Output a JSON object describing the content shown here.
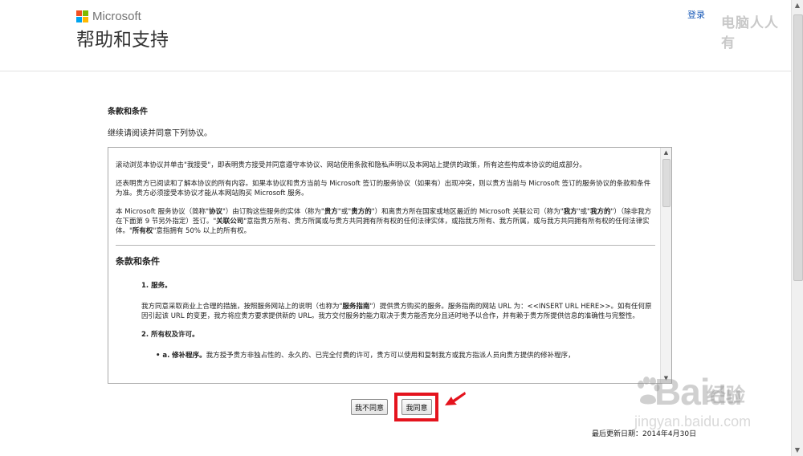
{
  "header": {
    "brand": "Microsoft",
    "title": "帮助和支持",
    "signin_label": "登录",
    "watermark": "电脑人人有"
  },
  "brand_colors": {
    "red": "#f25022",
    "green": "#7fba00",
    "blue": "#00a4ef",
    "yellow": "#ffb900"
  },
  "terms": {
    "heading": "条款和条件",
    "intro": "继续请阅读并同意下列协议。"
  },
  "agreement": {
    "p1": "滚动浏览本协议并单击\"我接受\"，即表明贵方接受并同意遵守本协议、网站使用条款和隐私声明以及本网站上提供的政策，所有这些构成本协议的组成部分。",
    "p2": "还表明贵方已阅读和了解本协议的所有内容。如果本协议和贵方当前与 Microsoft 签订的服务协议（如果有）出现冲突，则以贵方当前与 Microsoft 签订的服务协议的条款和条件为准。贵方必须接受本协议才能从本网站购买 Microsoft 服务。",
    "p3_a": "本 Microsoft 服务协议（简称\"",
    "p3_b": "协议",
    "p3_c": "\"）由订购这些服务的实体（称为\"",
    "p3_d": "贵方",
    "p3_e": "\"或\"",
    "p3_f": "贵方的",
    "p3_g": "\"）和离贵方所在国家或地区最近的 Microsoft 关联公司（称为\"",
    "p3_h": "我方",
    "p3_i": "\"或\"",
    "p3_j": "我方的",
    "p3_k": "\"）（除非我方在下面第 9 节另外指定）签订。\"",
    "p3_l": "关联公司",
    "p3_m": "\"意指贵方所有、贵方所属或与贵方共同拥有所有权的任何法律实体，或指我方所有、我方所属，或与我方共同拥有所有权的任何法律实体。\"",
    "p3_n": "所有权",
    "p3_o": "\"意指拥有 50% 以上的所有权。",
    "section_title": "条款和条件",
    "s1_title": "1. 服务。",
    "s1_a": "我方同意采取商业上合理的措施，按照服务网站上的说明（也称为\"",
    "s1_b": "服务指南",
    "s1_c": "\"）提供贵方购买的服务。服务指南的网站 URL 为：<<INSERT URL HERE>>。如有任何原因引起该 URL 的变更，我方将应贵方要求提供新的 URL。我方交付服务的能力取决于贵方能否充分且适时地予以合作，并有赖于贵方所提供信息的准确性与完整性。",
    "s2_title": "2. 所有权及许可。",
    "bullet_a": "• a.",
    "bullet_b": "修补程序。",
    "bullet_c": "我方授予贵方非独占性的、永久的、已完全付费的许可，贵方可以使用和复制我方或我方指派人员向贵方提供的修补程序，"
  },
  "buttons": {
    "decline_label": "我不同意",
    "accept_label": "我同意"
  },
  "footer": {
    "updated": "最后更新日期：2014年4月30日"
  },
  "baidu_watermark": {
    "brand_a": "Bai",
    "brand_b": "du",
    "brand_cn": "经验",
    "url": "jingyan.baidu.com"
  }
}
